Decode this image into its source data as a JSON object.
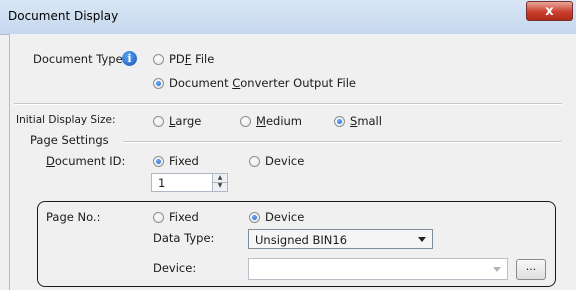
{
  "window": {
    "title": "Document Display",
    "close_label": "x"
  },
  "document_type": {
    "label": "Document Type:",
    "info_icon": "info-icon",
    "options": [
      {
        "pre": "PD",
        "key": "F",
        "post": " File",
        "selected": false
      },
      {
        "pre": "Document ",
        "key": "C",
        "post": "onverter Output File",
        "selected": true
      }
    ]
  },
  "initial_display_size": {
    "label": "Initial Display Size:",
    "options": [
      {
        "pre": "",
        "key": "L",
        "post": "arge",
        "selected": false
      },
      {
        "pre": "",
        "key": "M",
        "post": "edium",
        "selected": false
      },
      {
        "pre": "",
        "key": "S",
        "post": "mall",
        "selected": true
      }
    ]
  },
  "page_settings": {
    "title": "Page Settings",
    "document_id": {
      "label_key": "D",
      "label_rest": "ocument ID:",
      "fixed_label": "Fixed",
      "device_label": "Device",
      "selected": "Fixed",
      "value": "1"
    },
    "page_no": {
      "label": "Page No.:",
      "fixed_label": "Fixed",
      "device_label": "Device",
      "selected": "Device",
      "data_type_label": "Data Type:",
      "data_type_value": "Unsigned BIN16",
      "device_label_field": "Device:",
      "device_value": "",
      "browse_label": "..."
    }
  },
  "colors": {
    "highlight_border": "#1a1a1a",
    "radio_selected": "#1f5fc8"
  }
}
